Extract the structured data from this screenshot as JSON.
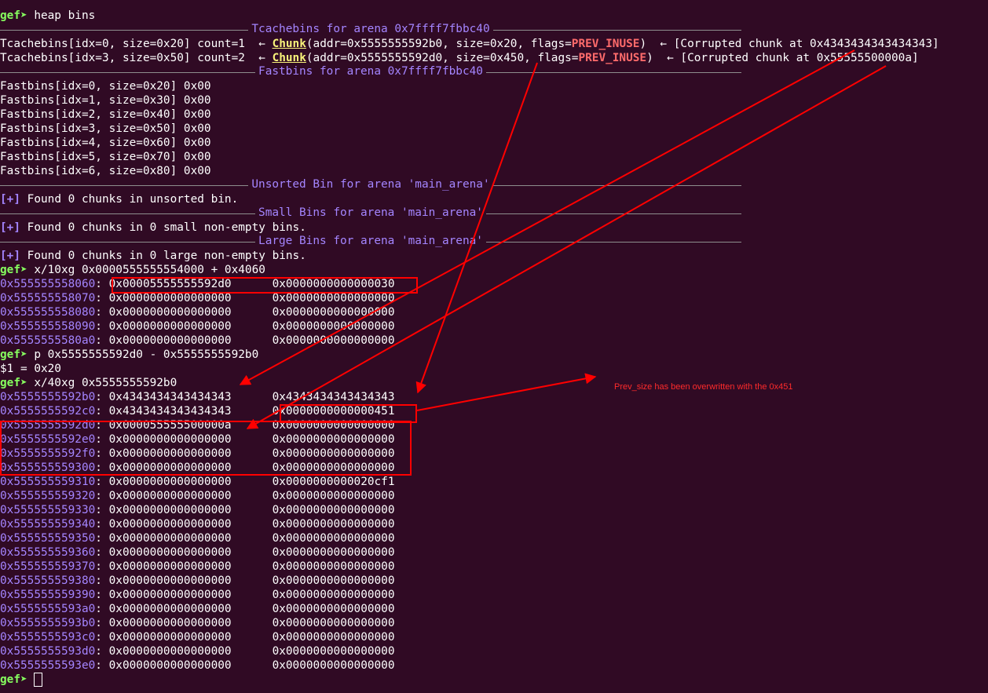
{
  "terminal": {
    "prompt": "gef➤",
    "cmd1": " heap bins",
    "tcache_header": "Tcachebins for arena 0x7ffff7fbbc40",
    "tcache": [
      {
        "pre": "Tcachebins[idx=0, size=0x20] count=1  ← ",
        "chunk": "Chunk",
        "mid": "(addr=0x5555555592b0, size=0x20, flags=",
        "flag": "PREV_INUSE",
        "post": ")  ← [Corrupted chunk at 0x4343434343434343]"
      },
      {
        "pre": "Tcachebins[idx=3, size=0x50] count=2  ← ",
        "chunk": "Chunk",
        "mid": "(addr=0x5555555592d0, size=0x450, flags=",
        "flag": "PREV_INUSE",
        "post": ")  ← [Corrupted chunk at 0x55555500000a]"
      }
    ],
    "fastbins_header": "Fastbins for arena 0x7ffff7fbbc40",
    "fastbins": [
      "Fastbins[idx=0, size=0x20] 0x00",
      "Fastbins[idx=1, size=0x30] 0x00",
      "Fastbins[idx=2, size=0x40] 0x00",
      "Fastbins[idx=3, size=0x50] 0x00",
      "Fastbins[idx=4, size=0x60] 0x00",
      "Fastbins[idx=5, size=0x70] 0x00",
      "Fastbins[idx=6, size=0x80] 0x00"
    ],
    "unsorted_header": "Unsorted Bin for arena 'main_arena'",
    "unsorted_plus": "[+]",
    "unsorted_msg": " Found 0 chunks in unsorted bin.",
    "small_header": "Small Bins for arena 'main_arena'",
    "small_plus": "[+]",
    "small_msg": " Found 0 chunks in 0 small non-empty bins.",
    "large_header": "Large Bins for arena 'main_arena'",
    "large_plus": "[+]",
    "large_msg": " Found 0 chunks in 0 large non-empty bins.",
    "cmd2": " x/10xg 0x0000555555554000 + 0x4060",
    "dump1": [
      {
        "addr": "0x555555558060",
        "v1": "0x00005555555592d0",
        "v2": "0x0000000000000030"
      },
      {
        "addr": "0x555555558070",
        "v1": "0x0000000000000000",
        "v2": "0x0000000000000000"
      },
      {
        "addr": "0x555555558080",
        "v1": "0x0000000000000000",
        "v2": "0x0000000000000000"
      },
      {
        "addr": "0x555555558090",
        "v1": "0x0000000000000000",
        "v2": "0x0000000000000000"
      },
      {
        "addr": "0x5555555580a0",
        "v1": "0x0000000000000000",
        "v2": "0x0000000000000000"
      }
    ],
    "cmd3": " p 0x5555555592d0 - 0x5555555592b0",
    "p_result": "$1 = 0x20",
    "cmd4": " x/40xg 0x5555555592b0",
    "dump2": [
      {
        "addr": "0x5555555592b0",
        "v1": "0x4343434343434343",
        "v2": "0x4343434343434343"
      },
      {
        "addr": "0x5555555592c0",
        "v1": "0x4343434343434343",
        "v2": "0x0000000000000451"
      },
      {
        "addr": "0x5555555592d0",
        "v1": "0x000055555500000a",
        "v2": "0x0000000000000000"
      },
      {
        "addr": "0x5555555592e0",
        "v1": "0x0000000000000000",
        "v2": "0x0000000000000000"
      },
      {
        "addr": "0x5555555592f0",
        "v1": "0x0000000000000000",
        "v2": "0x0000000000000000"
      },
      {
        "addr": "0x555555559300",
        "v1": "0x0000000000000000",
        "v2": "0x0000000000000000"
      },
      {
        "addr": "0x555555559310",
        "v1": "0x0000000000000000",
        "v2": "0x0000000000020cf1"
      },
      {
        "addr": "0x555555559320",
        "v1": "0x0000000000000000",
        "v2": "0x0000000000000000"
      },
      {
        "addr": "0x555555559330",
        "v1": "0x0000000000000000",
        "v2": "0x0000000000000000"
      },
      {
        "addr": "0x555555559340",
        "v1": "0x0000000000000000",
        "v2": "0x0000000000000000"
      },
      {
        "addr": "0x555555559350",
        "v1": "0x0000000000000000",
        "v2": "0x0000000000000000"
      },
      {
        "addr": "0x555555559360",
        "v1": "0x0000000000000000",
        "v2": "0x0000000000000000"
      },
      {
        "addr": "0x555555559370",
        "v1": "0x0000000000000000",
        "v2": "0x0000000000000000"
      },
      {
        "addr": "0x555555559380",
        "v1": "0x0000000000000000",
        "v2": "0x0000000000000000"
      },
      {
        "addr": "0x555555559390",
        "v1": "0x0000000000000000",
        "v2": "0x0000000000000000"
      },
      {
        "addr": "0x5555555593a0",
        "v1": "0x0000000000000000",
        "v2": "0x0000000000000000"
      },
      {
        "addr": "0x5555555593b0",
        "v1": "0x0000000000000000",
        "v2": "0x0000000000000000"
      },
      {
        "addr": "0x5555555593c0",
        "v1": "0x0000000000000000",
        "v2": "0x0000000000000000"
      },
      {
        "addr": "0x5555555593d0",
        "v1": "0x0000000000000000",
        "v2": "0x0000000000000000"
      },
      {
        "addr": "0x5555555593e0",
        "v1": "0x0000000000000000",
        "v2": "0x0000000000000000"
      }
    ]
  },
  "annotation": {
    "note": "Prev_size has been overwritten with the 0x451",
    "color": "#ff0000"
  },
  "colors": {
    "background": "#300a24",
    "prompt": "#87ff5f",
    "address": "#a485ff",
    "chunk": "#f8f37a",
    "flag": "#ff6b6b"
  }
}
